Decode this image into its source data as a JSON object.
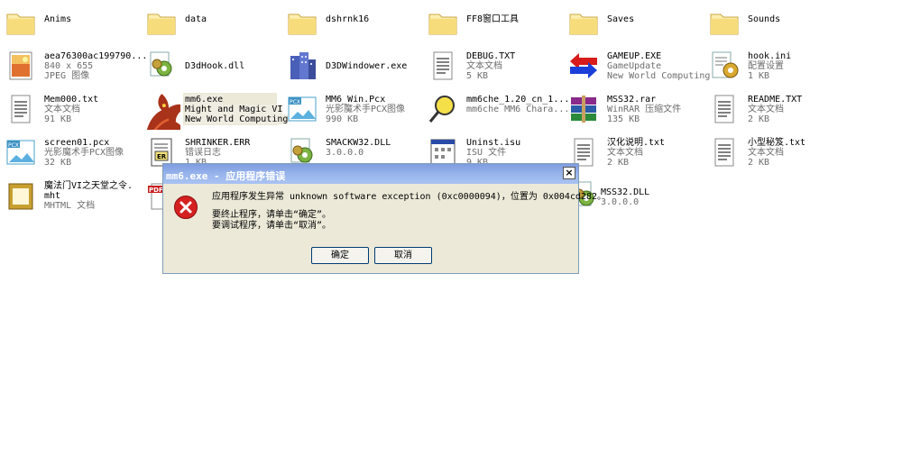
{
  "files": [
    {
      "name": "Anims",
      "type": "folder"
    },
    {
      "name": "data",
      "type": "folder"
    },
    {
      "name": "dshrnk16",
      "type": "folder"
    },
    {
      "name": "FF8窗口工具",
      "type": "folder"
    },
    {
      "name": "Saves",
      "type": "folder"
    },
    {
      "name": "Sounds",
      "type": "folder"
    },
    {
      "name": "aea76300ac199790...",
      "line2": "840 x 655",
      "line3": "JPEG 图像",
      "icon": "jpeg-image-icon"
    },
    {
      "name": "D3dHook.dll",
      "icon": "dll-gear-icon"
    },
    {
      "name": "D3DWindower.exe",
      "icon": "building-exe-icon"
    },
    {
      "name": "DEBUG.TXT",
      "line2": "文本文档",
      "line3": "5 KB",
      "icon": "text-document-icon"
    },
    {
      "name": "GAMEUP.EXE",
      "line2": "GameUpdate",
      "line3": "New World Computing",
      "icon": "red-blue-arrows-icon"
    },
    {
      "name": "hook.ini",
      "line2": "配置设置",
      "line3": "1 KB",
      "icon": "config-settings-icon"
    },
    {
      "name": "Mem000.txt",
      "line2": "文本文档",
      "line3": "91 KB",
      "icon": "text-document-icon"
    },
    {
      "name": "mm6.exe",
      "line2": "Might and Magic VI",
      "line3": "New World Computing",
      "icon": "dragon-icon"
    },
    {
      "name": "MM6_Win.Pcx",
      "line2": "光影魔术手PCX图像",
      "line3": "990 KB",
      "icon": "pcx-image-icon"
    },
    {
      "name": "mm6che_1.20_cn_1...",
      "line2": "mm6che MM6 Chara...",
      "line3": "",
      "icon": "magnifier-icon"
    },
    {
      "name": "MSS32.rar",
      "line2": "WinRAR 压缩文件",
      "line3": "135 KB",
      "icon": "winrar-archive-icon"
    },
    {
      "name": "README.TXT",
      "line2": "文本文档",
      "line3": "2 KB",
      "icon": "text-document-icon"
    },
    {
      "name": "screen01.pcx",
      "line2": "光影魔术手PCX图像",
      "line3": "32 KB",
      "icon": "pcx-image-icon"
    },
    {
      "name": "SHRINKER.ERR",
      "line2": "错误日志",
      "line3": "1 KB",
      "icon": "error-log-icon"
    },
    {
      "name": "SMACKW32.DLL",
      "line2": "3.0.0.0",
      "line3": "",
      "icon": "dll-gear-icon"
    },
    {
      "name": "Uninst.isu",
      "line2": "ISU 文件",
      "line3": "9 KB",
      "icon": "isu-file-icon"
    },
    {
      "name": "汉化说明.txt",
      "line2": "文本文档",
      "line3": "2 KB",
      "icon": "text-document-icon"
    },
    {
      "name": "小型秘笈.txt",
      "line2": "文本文档",
      "line3": "2 KB",
      "icon": "text-document-icon"
    },
    {
      "name": "魔法门VI之天堂之令.",
      "line2": "mht",
      "line3": "MHTML 文档",
      "icon": "mhtml-document-icon"
    },
    {
      "name": "",
      "line2": "",
      "line3": "",
      "icon": "pdf-document-icon"
    },
    {
      "name": "MSS32.DLL",
      "line2": "3.0.0.0",
      "line3": "",
      "icon": "dll-gear-icon"
    }
  ],
  "dialog": {
    "title": "mm6.exe - 应用程序错误",
    "close_label": "×",
    "message_line1": "应用程序发生异常 unknown software exception (0xc0000094)，位置为 0x004cd282。",
    "message_line2": "要终止程序，请单击“确定”。",
    "message_line3": "要调试程序，请单击“取消”。",
    "ok_label": "确定",
    "cancel_label": "取消",
    "icon": "error-x-icon"
  },
  "colors": {
    "titlebar": "#8fa9e6",
    "dialog_bg": "#ece9d8",
    "error_red": "#d52020"
  }
}
